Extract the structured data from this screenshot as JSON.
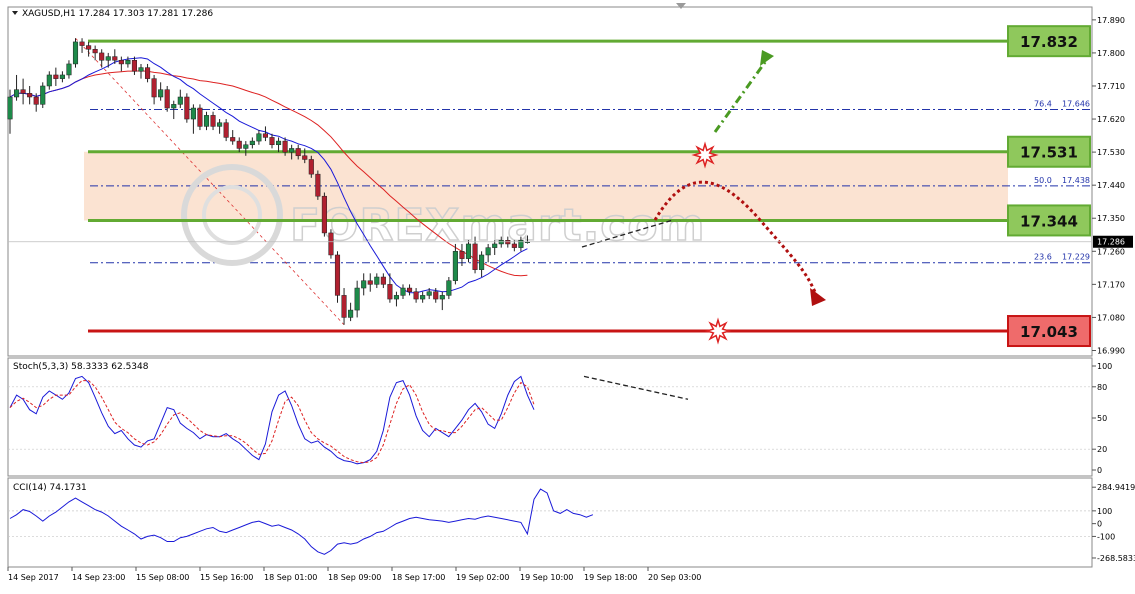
{
  "header": {
    "symbol_line": "XAGUSD,H1  17.284 17.303 17.281 17.286"
  },
  "watermark": "FOREXmart.com",
  "chart_data": {
    "type": "candlestick",
    "symbol": "XAGUSD",
    "timeframe": "H1",
    "ohlc_header": {
      "open": 17.284,
      "high": 17.303,
      "low": 17.281,
      "close": 17.286
    },
    "current_price": "17.286",
    "price_axis": {
      "range": [
        16.975,
        17.925
      ],
      "ticks": [
        "17.890",
        "17.800",
        "17.710",
        "17.620",
        "17.530",
        "17.440",
        "17.350",
        "17.260",
        "17.170",
        "17.080",
        "16.990"
      ]
    },
    "time_labels": [
      {
        "index": 0,
        "label": "14 Sep 2017"
      },
      {
        "index": 10,
        "label": "14 Sep 23:00"
      },
      {
        "index": 20,
        "label": "15 Sep 08:00"
      },
      {
        "index": 30,
        "label": "15 Sep 16:00"
      },
      {
        "index": 40,
        "label": "18 Sep 01:00"
      },
      {
        "index": 50,
        "label": "18 Sep 09:00"
      },
      {
        "index": 60,
        "label": "18 Sep 17:00"
      },
      {
        "index": 70,
        "label": "19 Sep 02:00"
      },
      {
        "index": 80,
        "label": "19 Sep 10:00"
      },
      {
        "index": 90,
        "label": "19 Sep 18:00"
      },
      {
        "index": 100,
        "label": "20 Sep 03:00"
      }
    ],
    "candles": [
      [
        17.62,
        17.7,
        17.58,
        17.68
      ],
      [
        17.68,
        17.74,
        17.67,
        17.7
      ],
      [
        17.7,
        17.73,
        17.66,
        17.69
      ],
      [
        17.69,
        17.71,
        17.66,
        17.68
      ],
      [
        17.68,
        17.69,
        17.64,
        17.66
      ],
      [
        17.66,
        17.72,
        17.65,
        17.71
      ],
      [
        17.71,
        17.75,
        17.7,
        17.74
      ],
      [
        17.74,
        17.76,
        17.71,
        17.73
      ],
      [
        17.73,
        17.75,
        17.72,
        17.74
      ],
      [
        17.74,
        17.78,
        17.73,
        17.77
      ],
      [
        17.77,
        17.84,
        17.76,
        17.83
      ],
      [
        17.83,
        17.84,
        17.8,
        17.82
      ],
      [
        17.82,
        17.83,
        17.79,
        17.81
      ],
      [
        17.81,
        17.82,
        17.78,
        17.8
      ],
      [
        17.8,
        17.81,
        17.76,
        17.78
      ],
      [
        17.78,
        17.8,
        17.76,
        17.79
      ],
      [
        17.79,
        17.81,
        17.77,
        17.78
      ],
      [
        17.78,
        17.79,
        17.75,
        17.77
      ],
      [
        17.77,
        17.79,
        17.76,
        17.78
      ],
      [
        17.78,
        17.79,
        17.74,
        17.75
      ],
      [
        17.75,
        17.77,
        17.73,
        17.76
      ],
      [
        17.76,
        17.77,
        17.72,
        17.73
      ],
      [
        17.73,
        17.74,
        17.66,
        17.68
      ],
      [
        17.68,
        17.72,
        17.67,
        17.7
      ],
      [
        17.7,
        17.71,
        17.64,
        17.65
      ],
      [
        17.65,
        17.67,
        17.62,
        17.66
      ],
      [
        17.66,
        17.7,
        17.65,
        17.68
      ],
      [
        17.68,
        17.69,
        17.61,
        17.62
      ],
      [
        17.62,
        17.66,
        17.58,
        17.65
      ],
      [
        17.65,
        17.66,
        17.59,
        17.6
      ],
      [
        17.6,
        17.64,
        17.59,
        17.63
      ],
      [
        17.63,
        17.64,
        17.59,
        17.6
      ],
      [
        17.6,
        17.62,
        17.58,
        17.61
      ],
      [
        17.61,
        17.62,
        17.56,
        17.57
      ],
      [
        17.57,
        17.59,
        17.55,
        17.56
      ],
      [
        17.56,
        17.57,
        17.53,
        17.54
      ],
      [
        17.54,
        17.56,
        17.52,
        17.55
      ],
      [
        17.55,
        17.57,
        17.54,
        17.56
      ],
      [
        17.56,
        17.59,
        17.55,
        17.58
      ],
      [
        17.58,
        17.6,
        17.56,
        17.57
      ],
      [
        17.57,
        17.58,
        17.54,
        17.55
      ],
      [
        17.55,
        17.57,
        17.53,
        17.56
      ],
      [
        17.56,
        17.57,
        17.52,
        17.53
      ],
      [
        17.53,
        17.55,
        17.51,
        17.54
      ],
      [
        17.54,
        17.55,
        17.51,
        17.52
      ],
      [
        17.52,
        17.54,
        17.5,
        17.51
      ],
      [
        17.51,
        17.52,
        17.46,
        17.47
      ],
      [
        17.47,
        17.48,
        17.4,
        17.41
      ],
      [
        17.41,
        17.42,
        17.3,
        17.31
      ],
      [
        17.31,
        17.32,
        17.24,
        17.25
      ],
      [
        17.25,
        17.26,
        17.12,
        17.14
      ],
      [
        17.14,
        17.16,
        17.06,
        17.08
      ],
      [
        17.08,
        17.12,
        17.07,
        17.1
      ],
      [
        17.1,
        17.18,
        17.08,
        17.16
      ],
      [
        17.16,
        17.2,
        17.14,
        17.18
      ],
      [
        17.18,
        17.2,
        17.15,
        17.17
      ],
      [
        17.17,
        17.2,
        17.16,
        17.19
      ],
      [
        17.19,
        17.2,
        17.16,
        17.17
      ],
      [
        17.17,
        17.2,
        17.12,
        17.13
      ],
      [
        17.13,
        17.15,
        17.11,
        17.14
      ],
      [
        17.14,
        17.17,
        17.13,
        17.16
      ],
      [
        17.16,
        17.17,
        17.14,
        17.15
      ],
      [
        17.15,
        17.16,
        17.12,
        17.13
      ],
      [
        17.13,
        17.15,
        17.12,
        17.14
      ],
      [
        17.14,
        17.16,
        17.13,
        17.15
      ],
      [
        17.15,
        17.16,
        17.12,
        17.13
      ],
      [
        17.13,
        17.15,
        17.1,
        17.14
      ],
      [
        17.14,
        17.19,
        17.13,
        17.18
      ],
      [
        17.18,
        17.28,
        17.17,
        17.26
      ],
      [
        17.26,
        17.28,
        17.22,
        17.24
      ],
      [
        17.24,
        17.29,
        17.23,
        17.28
      ],
      [
        17.28,
        17.3,
        17.2,
        17.21
      ],
      [
        17.21,
        17.26,
        17.19,
        17.25
      ],
      [
        17.25,
        17.28,
        17.23,
        17.27
      ],
      [
        17.27,
        17.29,
        17.25,
        17.28
      ],
      [
        17.28,
        17.3,
        17.27,
        17.29
      ],
      [
        17.29,
        17.3,
        17.27,
        17.28
      ],
      [
        17.28,
        17.29,
        17.26,
        17.27
      ],
      [
        17.27,
        17.3,
        17.26,
        17.29
      ],
      [
        17.284,
        17.303,
        17.281,
        17.286
      ]
    ],
    "moving_averages": [
      {
        "name": "ma-red",
        "color": "#dd2222"
      },
      {
        "name": "ma-blue",
        "color": "#1a1ad8"
      }
    ],
    "horizontal_levels": [
      {
        "value": 17.832,
        "label": "17.832",
        "color": "#62aa33",
        "box_bg": "#8fc85c"
      },
      {
        "value": 17.531,
        "label": "17.531",
        "color": "#62aa33",
        "box_bg": "#8fc85c"
      },
      {
        "value": 17.344,
        "label": "17.344",
        "color": "#62aa33",
        "box_bg": "#8fc85c"
      },
      {
        "value": 17.043,
        "label": "17.043",
        "color": "#c81414",
        "box_bg": "#ef6b6b"
      }
    ],
    "zone": {
      "from": 17.344,
      "to": 17.531,
      "color": "#fbe3d2"
    },
    "fibonacci": [
      {
        "level": "76.4",
        "price": "17.646",
        "value": 17.646
      },
      {
        "level": "50.0",
        "price": "17.438",
        "value": 17.438
      },
      {
        "level": "23.6",
        "price": "17.229",
        "value": 17.229
      }
    ],
    "stochastic": {
      "label": "Stoch(5,3,3) 58.3333 62.5348",
      "range": [
        0,
        100
      ],
      "ticks": [
        "100",
        "80",
        "50",
        "20",
        "0"
      ],
      "main": [
        60,
        72,
        68,
        58,
        54,
        70,
        76,
        72,
        68,
        74,
        88,
        90,
        84,
        70,
        55,
        42,
        35,
        38,
        30,
        24,
        22,
        28,
        30,
        45,
        60,
        58,
        45,
        40,
        36,
        30,
        34,
        32,
        32,
        35,
        30,
        26,
        20,
        14,
        10,
        25,
        56,
        72,
        76,
        62,
        44,
        30,
        26,
        28,
        22,
        18,
        12,
        9,
        8,
        6,
        7,
        10,
        18,
        38,
        70,
        84,
        86,
        72,
        52,
        38,
        32,
        40,
        36,
        32,
        40,
        48,
        58,
        64,
        56,
        44,
        40,
        54,
        72,
        85,
        90,
        72,
        58
      ],
      "signal": [
        60,
        66,
        69,
        65,
        60,
        62,
        68,
        72,
        72,
        72,
        80,
        86,
        86,
        80,
        70,
        58,
        46,
        40,
        36,
        30,
        26,
        24,
        27,
        34,
        44,
        53,
        55,
        50,
        44,
        38,
        34,
        33,
        32,
        33,
        33,
        30,
        26,
        20,
        15,
        16,
        28,
        48,
        66,
        70,
        62,
        48,
        36,
        30,
        26,
        23,
        18,
        13,
        10,
        8,
        7,
        8,
        12,
        24,
        44,
        64,
        78,
        82,
        72,
        56,
        44,
        38,
        38,
        36,
        36,
        42,
        50,
        58,
        60,
        54,
        48,
        48,
        60,
        74,
        84,
        80,
        63
      ]
    },
    "cci": {
      "label": "CCI(14) 74.1731",
      "range": [
        -300,
        310
      ],
      "ticks": [
        "284.9419",
        "100",
        "0",
        "-100",
        "-268.5833"
      ],
      "values": [
        40,
        70,
        110,
        95,
        60,
        20,
        60,
        90,
        130,
        170,
        200,
        170,
        140,
        110,
        90,
        60,
        20,
        -20,
        -50,
        -80,
        -120,
        -100,
        -90,
        -110,
        -140,
        -140,
        -110,
        -100,
        -80,
        -60,
        -40,
        -30,
        -60,
        -70,
        -50,
        -30,
        -10,
        10,
        20,
        0,
        -20,
        -10,
        -30,
        -50,
        -80,
        -120,
        -180,
        -220,
        -240,
        -210,
        -160,
        -150,
        -160,
        -150,
        -120,
        -100,
        -70,
        -60,
        -30,
        0,
        20,
        40,
        50,
        40,
        30,
        25,
        20,
        10,
        20,
        30,
        40,
        35,
        50,
        60,
        50,
        40,
        30,
        20,
        10,
        -80,
        190,
        270,
        240,
        100,
        80,
        110,
        80,
        70,
        50,
        70
      ],
      "zero_line": 0
    },
    "annotations": {
      "projections": [
        "up-to-17.832",
        "down-to-17.043"
      ],
      "star_marks": [
        "breakout-17.531",
        "target-17.043"
      ],
      "trendlines": [
        "price-rising-wedge",
        "stoch-falling-divergence"
      ]
    }
  }
}
